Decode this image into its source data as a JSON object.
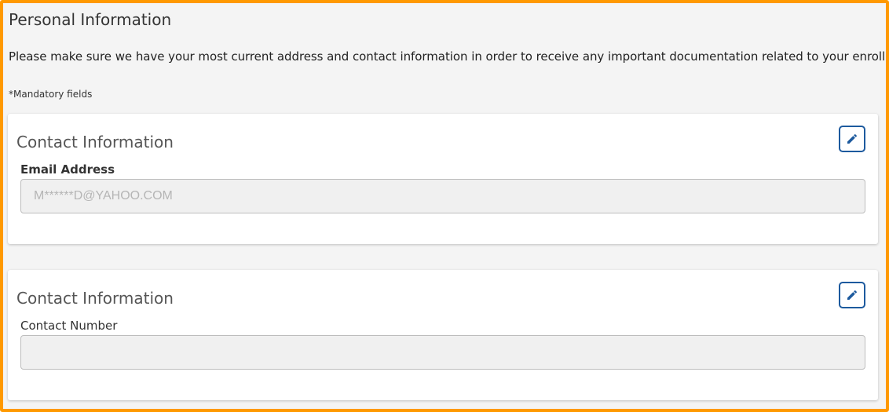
{
  "page": {
    "title": "Personal Information",
    "intro": "Please make sure we have your most current address and contact information in order to receive any important documentation related to your enrollment",
    "mandatory_note": "*Mandatory fields"
  },
  "email_card": {
    "title": "Contact Information",
    "edit_icon": "pencil-icon",
    "field_label": "Email Address",
    "field_value": "M******D@YAHOO.COM"
  },
  "phone_card": {
    "title": "Contact Information",
    "edit_icon": "pencil-icon",
    "field_label": "Contact Number",
    "field_value": ""
  },
  "colors": {
    "highlight_border": "#ff9900",
    "accent": "#1d5a9e",
    "page_background": "#f4f4f4",
    "input_background": "#f0f0f0"
  }
}
